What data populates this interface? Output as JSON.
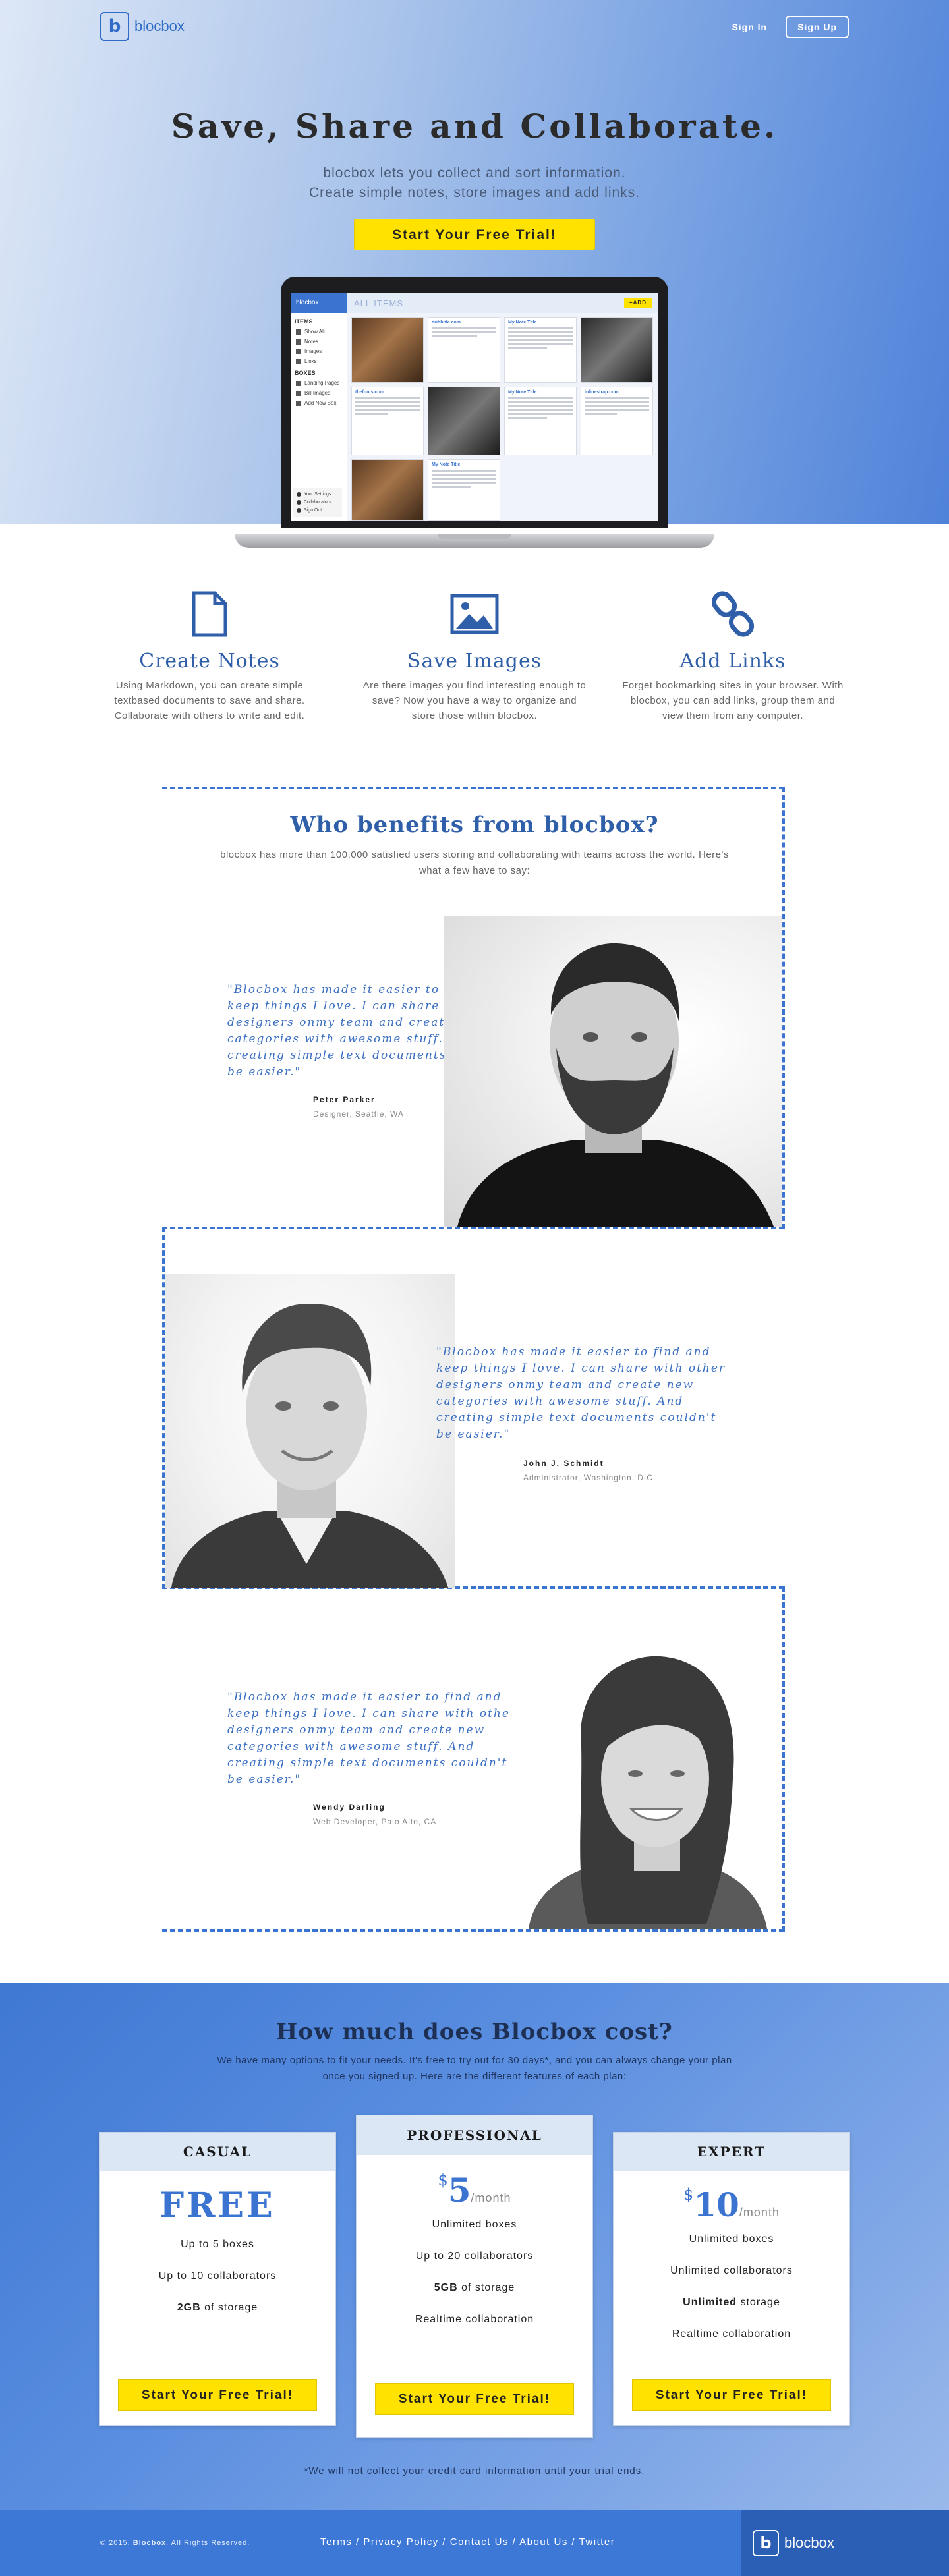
{
  "brand": {
    "name": "blocbox",
    "logo_letter": "b"
  },
  "nav": {
    "signin": "Sign In",
    "signup": "Sign Up"
  },
  "hero": {
    "title": "Save, Share and Collaborate.",
    "subtitle_line1": "blocbox lets you collect and sort information.",
    "subtitle_line2": "Create simple notes, store images and add links.",
    "cta": "Start Your Free Trial!"
  },
  "app_mock": {
    "header": "blocbox",
    "top_title": "ALL ITEMS",
    "add_label": "+ADD",
    "items_title": "ITEMS",
    "items": [
      "Show All",
      "Notes",
      "Images",
      "Links"
    ],
    "boxes_title": "BOXES",
    "boxes": [
      "Landing Pages",
      "Bill Images",
      "Add New Box"
    ],
    "bottom": [
      "Your Settings",
      "Collaborators",
      "Sign Out"
    ],
    "cards": [
      "dribbble.com",
      "My Note Title",
      "thefonts.com",
      "My Note Title",
      "inlinestrap.com",
      "My Note Title"
    ]
  },
  "features": [
    {
      "icon": "document-icon",
      "title": "Create Notes",
      "text": "Using Markdown, you can create simple textbased documents to save and share. Collaborate with others to write and edit."
    },
    {
      "icon": "image-icon",
      "title": "Save Images",
      "text": "Are there images you find interesting enough to save? Now you have a way to organize and store those within blocbox."
    },
    {
      "icon": "link-icon",
      "title": "Add Links",
      "text": "Forget bookmarking sites in your browser. With blocbox, you can add links, group them and view them from any computer."
    }
  ],
  "benefits": {
    "title": "Who benefits from blocbox?",
    "subtitle": "blocbox has more than 100,000 satisfied users storing and collaborating with teams across the world. Here's what a few have to say:",
    "testimonials": [
      {
        "quote": "\"Blocbox has made it easier to find and keep things I love. I can share with other designers onmy team and create new categories with awesome stuff. And creating simple text documents couldn't be easier.\"",
        "name": "Peter Parker",
        "role": "Designer, Seattle, WA"
      },
      {
        "quote": "\"Blocbox has made it easier to find and keep things I love. I can share with other designers onmy team and create new categories with awesome stuff. And creating simple text documents couldn't be easier.\"",
        "name": "John J. Schmidt",
        "role": "Administrator, Washington, D.C."
      },
      {
        "quote": "\"Blocbox has made it easier to find and keep things I love. I can share with other designers onmy team and create new categories with awesome stuff. And creating simple text documents couldn't be easier.\"",
        "name": "Wendy Darling",
        "role": "Web Developer, Palo Alto, CA"
      }
    ]
  },
  "pricing": {
    "title": "How much does Blocbox cost?",
    "subtitle": "We have many options to fit your needs. It's free to try out for 30 days*, and you can always change your plan once you signed up. Here are the different features of each plan:",
    "plans": [
      {
        "name": "CASUAL",
        "price": "FREE",
        "features": [
          "Up to 5 boxes",
          "Up to 10 collaborators",
          "2GB",
          "of storage"
        ],
        "cta": "Start Your Free Trial!"
      },
      {
        "name": "PROFESSIONAL",
        "currency": "$",
        "price": "5",
        "period": "/month",
        "features": [
          "Unlimited boxes",
          "Up to 20 collaborators",
          "5GB",
          "of storage",
          "Realtime collaboration"
        ],
        "cta": "Start Your Free Trial!"
      },
      {
        "name": "EXPERT",
        "currency": "$",
        "price": "10",
        "period": "/month",
        "features": [
          "Unlimited boxes",
          "Unlimited collaborators",
          "Unlimited",
          "storage",
          "Realtime collaboration"
        ],
        "cta": "Start Your Free Trial!"
      }
    ],
    "note": "*We will not collect your credit card information until your trial ends."
  },
  "footer": {
    "copy_prefix": "© 2015.",
    "copy_brand": "Blocbox",
    "copy_suffix": ". All Rights Reserved.",
    "links": [
      "Terms",
      "Privacy Policy",
      "Contact Us",
      "About Us",
      "Twitter"
    ],
    "link_sep": " / "
  },
  "colors": {
    "accent": "#3b74d0",
    "cta": "#ffe200",
    "heading": "#2f5fa8"
  }
}
